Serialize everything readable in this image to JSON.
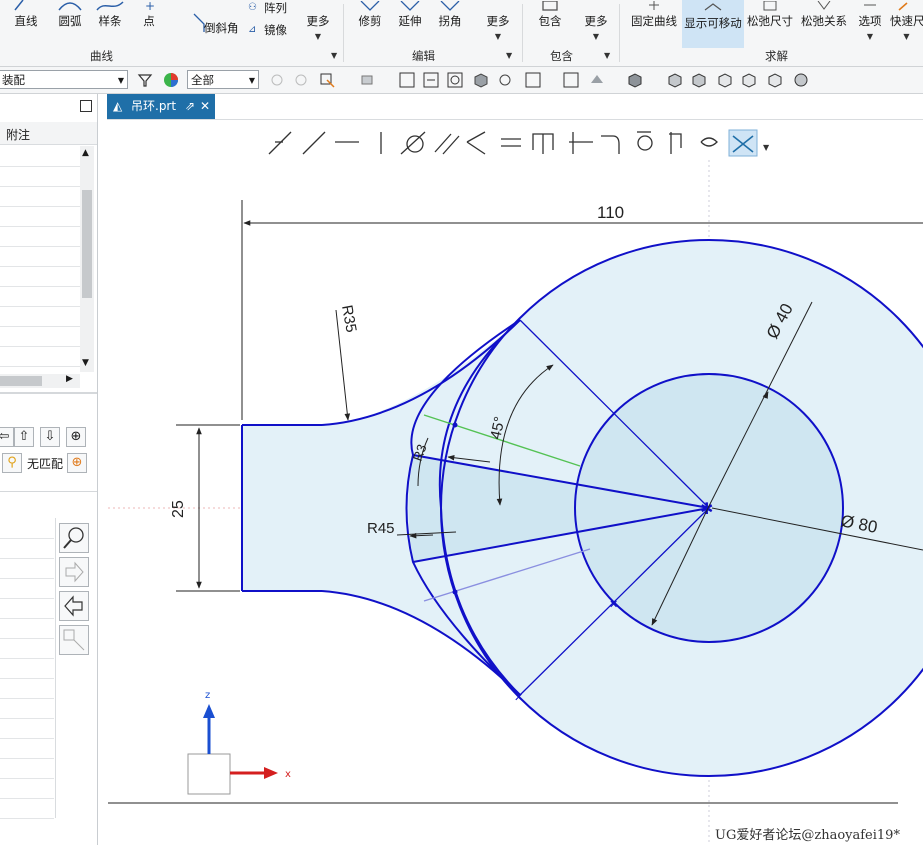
{
  "ribbon": {
    "curve_group": {
      "label": "曲线",
      "buttons": [
        {
          "label": "直线"
        },
        {
          "label": "圆弧"
        },
        {
          "label": "样条"
        },
        {
          "label": "点"
        },
        {
          "label": "倒斜角"
        },
        {
          "label": "阵列"
        },
        {
          "label": "镜像"
        },
        {
          "label": "更多"
        }
      ]
    },
    "edit_group": {
      "label": "编辑",
      "buttons": [
        {
          "label": "修剪"
        },
        {
          "label": "延伸"
        },
        {
          "label": "拐角"
        },
        {
          "label": "更多"
        }
      ]
    },
    "wrap_group": {
      "label": "包含",
      "buttons": [
        {
          "label": "包含"
        },
        {
          "label": "更多"
        }
      ]
    },
    "solve_group": {
      "label": "求解",
      "buttons": [
        {
          "label": "固定曲线",
          "active": false
        },
        {
          "label": "显示可移动",
          "active": true
        },
        {
          "label": "松弛尺寸",
          "active": false
        },
        {
          "label": "松弛关系",
          "active": false
        },
        {
          "label": "选项",
          "active": false
        },
        {
          "label": "快速尺",
          "active": false
        }
      ]
    }
  },
  "toolbar": {
    "filter_value": "装配",
    "scope_value": "全部"
  },
  "left_panel": {
    "column_header": "附注",
    "match_label": "无匹配"
  },
  "tab": {
    "title": "吊环.prt"
  },
  "drawing": {
    "dimensions": {
      "overall_length": "110",
      "inner_diameter": "Ø 40",
      "outer_diameter": "Ø 80",
      "fillet_radius": "R35",
      "arc_radius": "R45",
      "angle": "45°",
      "width": "25",
      "small_radius": "R3"
    },
    "axes": {
      "z": "z",
      "x": "x"
    },
    "colors": {
      "geometry": "#1010c8",
      "fill": "#dcedf7",
      "dimension": "#222222",
      "accent_green": "#54c254",
      "accent_violet": "#8a8fe0"
    }
  },
  "watermark": "UG爱好者论坛@zhaoyafei19*"
}
